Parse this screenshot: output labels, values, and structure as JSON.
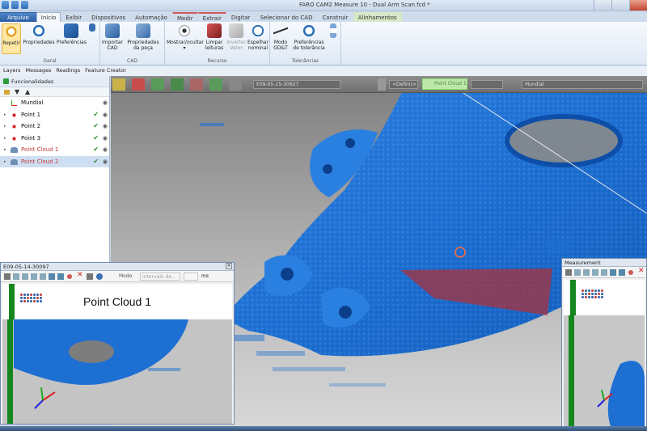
{
  "window": {
    "title": "FARO CAM2 Measure 10 - Dual Arm Scan.fcd *"
  },
  "tabs": [
    {
      "label": "Arquivo",
      "style": "file"
    },
    {
      "label": "Início",
      "style": "active"
    },
    {
      "label": "Exibir",
      "style": ""
    },
    {
      "label": "Dispositivos",
      "style": ""
    },
    {
      "label": "Automação",
      "style": ""
    },
    {
      "label": "Medir",
      "style": "cad"
    },
    {
      "label": "Extrair",
      "style": "cad"
    },
    {
      "label": "Digitar",
      "style": ""
    },
    {
      "label": "Selecionar do CAD",
      "style": ""
    },
    {
      "label": "Construir",
      "style": ""
    },
    {
      "label": "Alinhamentos",
      "style": "ctx"
    }
  ],
  "ribbon": {
    "groups": {
      "geral": "Geral",
      "cad": "CAD",
      "recurso": "Recurso",
      "tolerancias": "Tolerâncias"
    },
    "buttons": {
      "repetir": "Repetir",
      "propriedades": "Propriedades",
      "preferencias": "Preferências",
      "importar_cad": "Importar CAD",
      "propriedades_peca": "Propriedades da peça",
      "mostrar_ocultar": "Mostrar/ocultar",
      "limpar_leituras": "Limpar leituras",
      "inverter_vetor": "Inverter Vetor",
      "espelhar_nominal": "Espelhar nominal",
      "modo_gdt": "Modo GD&T",
      "preferencias_tolerancia": "Preferências de tolerância"
    }
  },
  "infobar": [
    "Layers",
    "Messages",
    "Readings",
    "Feature Creator"
  ],
  "feature_panel": {
    "title": "Funcionalidades",
    "items": [
      {
        "label": "Mundial",
        "icon": "axis-icon",
        "color": "#111",
        "checked": false,
        "selected": false
      },
      {
        "label": "Point 1",
        "icon": "point-icon",
        "color": "#111",
        "checked": true,
        "selected": false
      },
      {
        "label": "Point 2",
        "icon": "point-icon",
        "color": "#111",
        "checked": true,
        "selected": false
      },
      {
        "label": "Point 3",
        "icon": "point-icon",
        "color": "#111",
        "checked": true,
        "selected": false
      },
      {
        "label": "Point Cloud 1",
        "icon": "cloud-icon",
        "color": "#c23a3a",
        "checked": true,
        "selected": false
      },
      {
        "label": "Point Cloud 2",
        "icon": "cloud-icon",
        "color": "#c23a3a",
        "checked": true,
        "selected": true
      }
    ]
  },
  "viewport_toolbar": {
    "scan_id": "E09-05-15-30627",
    "definir": "<Definir>",
    "point_cloud": "Point Cloud 1",
    "frame": "Mundial"
  },
  "window_left": {
    "title": "E09-05-14-30097",
    "modo_label": "Modo",
    "modo_value": "Intervalo de...",
    "unit": "ms",
    "feature_name": "Point Cloud 1"
  },
  "window_right": {
    "title": "Measurement"
  },
  "colors": {
    "scan_blue": "#1e6fd2",
    "green_bar": "#16861e",
    "highlight_red": "#a8323c"
  }
}
